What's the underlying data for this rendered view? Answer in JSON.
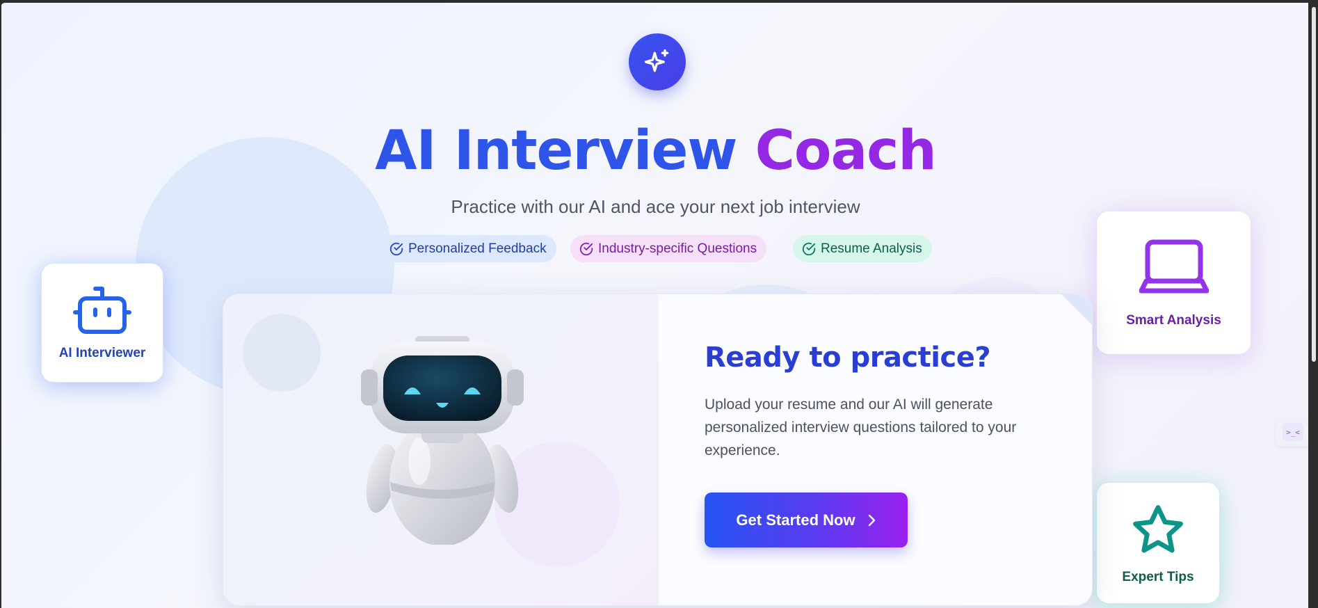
{
  "header": {
    "logo_icon": "sparkles-icon",
    "title_part1": "AI Interview",
    "title_part2": "Coach",
    "subtitle": "Practice with our AI and ace your next job interview"
  },
  "features": [
    {
      "label": "Personalized Feedback",
      "icon": "check-circle-icon",
      "color": "#1f3fa6"
    },
    {
      "label": "Industry-specific Questions",
      "icon": "check-circle-icon",
      "color": "#7a1aa6"
    },
    {
      "label": "Resume Analysis",
      "icon": "check-circle-icon",
      "color": "#0e5e4a"
    }
  ],
  "side_cards": {
    "interviewer": {
      "label": "AI Interviewer",
      "icon": "robot-icon",
      "color": "#2563eb"
    },
    "analysis": {
      "label": "Smart Analysis",
      "icon": "laptop-icon",
      "color": "#9333ea"
    },
    "tips": {
      "label": "Expert Tips",
      "icon": "star-icon",
      "color": "#0d9488"
    }
  },
  "main_card": {
    "heading": "Ready to practice?",
    "description": "Upload your resume and our AI will generate personalized interview questions tailored to your experience.",
    "cta_label": "Get Started Now",
    "cta_icon": "chevron-right-icon",
    "illustration": "robot-illustration"
  },
  "widget": {
    "glyph": ">_<"
  },
  "colors": {
    "primary": "#2f54ea",
    "accent": "#9428e4"
  }
}
